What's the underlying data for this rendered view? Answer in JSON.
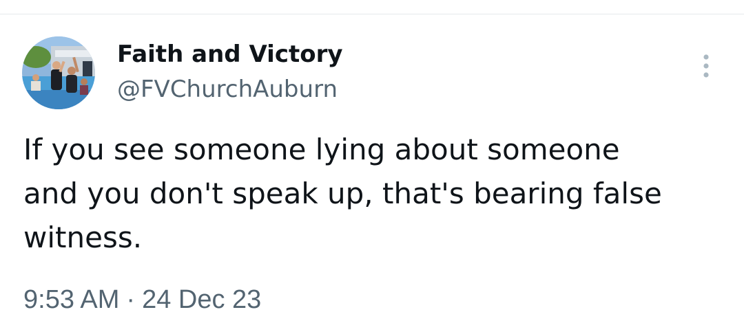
{
  "author": {
    "name": "Faith and Victory",
    "handle": "@FVChurchAuburn"
  },
  "tweet": {
    "lines": [
      "If you see someone lying about someone",
      "and you don't speak up, that's bearing false",
      "witness."
    ],
    "time": "9:53 AM",
    "separator": "·",
    "date": "24 Dec 23"
  },
  "icons": {
    "more": "more-vertical-icon",
    "avatar": "profile-photo"
  },
  "colors": {
    "text_primary": "#0f1419",
    "text_secondary": "#536471",
    "icon_gray": "#aab8c2",
    "divider": "#e6e9ec"
  }
}
